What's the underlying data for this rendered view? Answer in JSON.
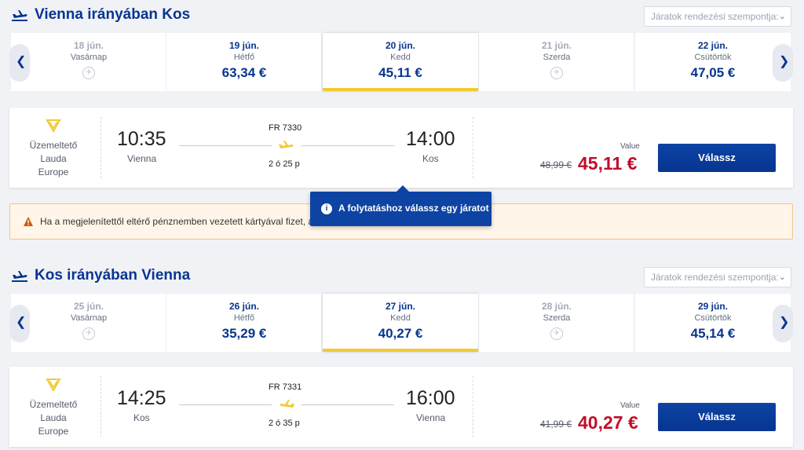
{
  "outbound": {
    "title": "Vienna irányában Kos",
    "sort_placeholder": "Járatok rendezési szempontja:",
    "dates": [
      {
        "date": "18 jún.",
        "weekday": "Vasárnap",
        "price": "",
        "available": false
      },
      {
        "date": "19 jún.",
        "weekday": "Hétfő",
        "price": "63,34 €",
        "available": true
      },
      {
        "date": "20 jún.",
        "weekday": "Kedd",
        "price": "45,11 €",
        "available": true,
        "selected": true
      },
      {
        "date": "21 jún.",
        "weekday": "Szerda",
        "price": "",
        "available": false
      },
      {
        "date": "22 jún.",
        "weekday": "Csütörtök",
        "price": "47,05 €",
        "available": true
      }
    ],
    "flight": {
      "operator_label": "Üzemeltető",
      "operator_name_1": "Lauda",
      "operator_name_2": "Europe",
      "dep_time": "10:35",
      "dep_city": "Vienna",
      "flight_number": "FR 7330",
      "duration": "2 ó 25 p",
      "arr_time": "14:00",
      "arr_city": "Kos",
      "fare_label": "Value",
      "old_price": "48,99 €",
      "price": "45,11 €",
      "button_label": "Válassz"
    }
  },
  "warning": {
    "text": "Ha a megjelenítettől eltérő pénznemben vezetett kártyával fizet, a"
  },
  "tooltip": {
    "text": "A folytatáshoz válassz egy járatot"
  },
  "inbound": {
    "title": "Kos irányában Vienna",
    "sort_placeholder": "Járatok rendezési szempontja:",
    "dates": [
      {
        "date": "25 jún.",
        "weekday": "Vasárnap",
        "price": "",
        "available": false
      },
      {
        "date": "26 jún.",
        "weekday": "Hétfő",
        "price": "35,29 €",
        "available": true
      },
      {
        "date": "27 jún.",
        "weekday": "Kedd",
        "price": "40,27 €",
        "available": true,
        "selected": true
      },
      {
        "date": "28 jún.",
        "weekday": "Szerda",
        "price": "",
        "available": false
      },
      {
        "date": "29 jún.",
        "weekday": "Csütörtök",
        "price": "45,14 €",
        "available": true
      }
    ],
    "flight": {
      "operator_label": "Üzemeltető",
      "operator_name_1": "Lauda",
      "operator_name_2": "Europe",
      "dep_time": "14:25",
      "dep_city": "Kos",
      "flight_number": "FR 7331",
      "duration": "2 ó 35 p",
      "arr_time": "16:00",
      "arr_city": "Vienna",
      "fare_label": "Value",
      "old_price": "41,99 €",
      "price": "40,27 €",
      "button_label": "Válassz"
    }
  },
  "colors": {
    "brand_blue": "#073590",
    "accent_yellow": "#f1c933",
    "price_red": "#c00f2a"
  }
}
